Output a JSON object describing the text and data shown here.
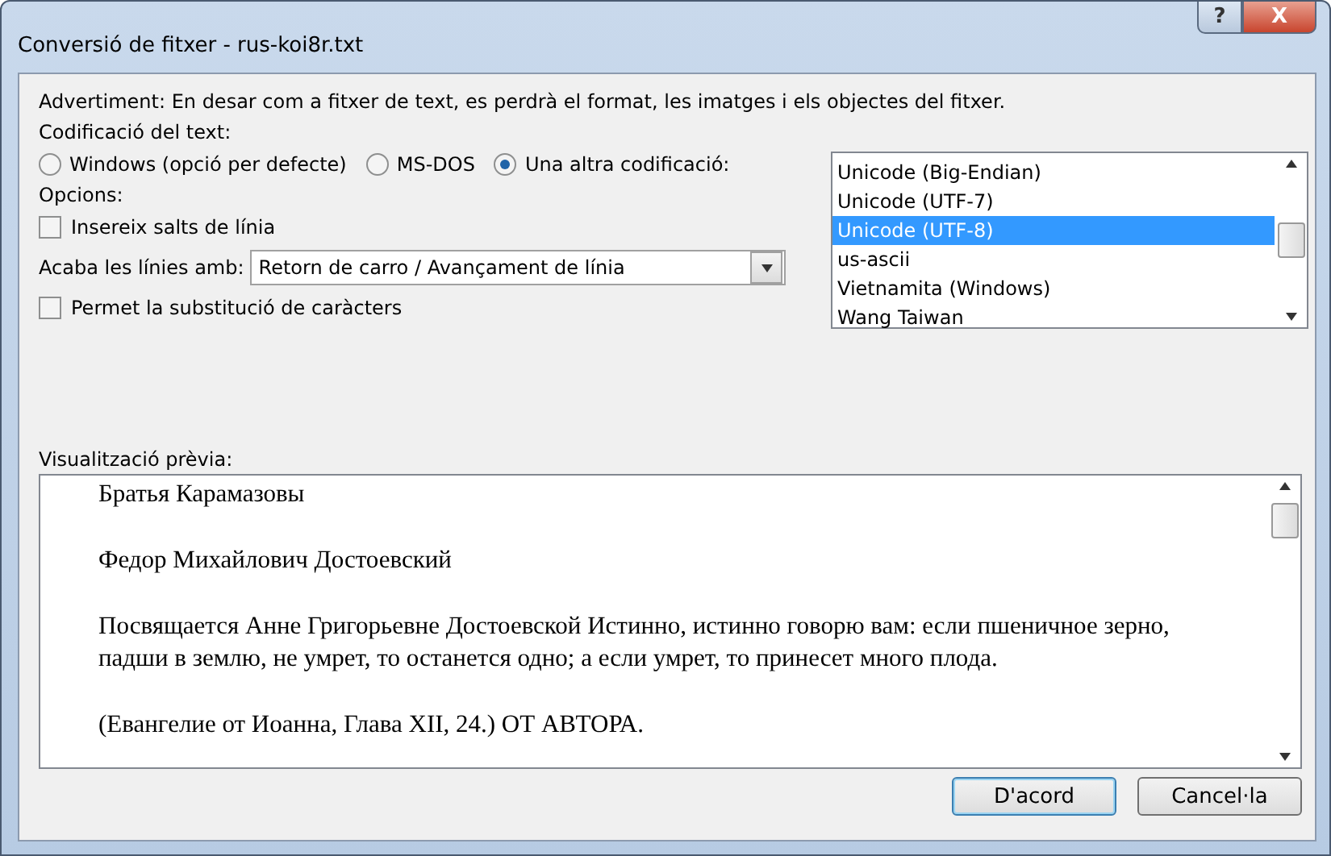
{
  "window": {
    "title": "Conversió de fitxer - rus-koi8r.txt",
    "buttons": [
      "?",
      "X"
    ]
  },
  "warning": "Advertiment: En desar com a fitxer de text, es perdrà el format, les imatges i els objectes del fitxer.",
  "encoding_label": "Codificació del text:",
  "encoding_options": [
    {
      "label": "Windows (opció per defecte)",
      "selected": false
    },
    {
      "label": "MS-DOS",
      "selected": false
    },
    {
      "label": "Una altra codificació:",
      "selected": true
    }
  ],
  "encodings": [
    {
      "label": "Unicode (Big-Endian)",
      "selected": false
    },
    {
      "label": "Unicode (UTF-7)",
      "selected": false
    },
    {
      "label": "Unicode (UTF-8)",
      "selected": true
    },
    {
      "label": "us-ascii",
      "selected": false
    },
    {
      "label": "Vietnamita (Windows)",
      "selected": false
    },
    {
      "label": "Wang Taiwan",
      "selected": false
    }
  ],
  "options_label": "Opcions:",
  "insert_breaks": {
    "label": "Insereix salts de línia",
    "checked": false
  },
  "line_end": {
    "label": "Acaba les línies amb:",
    "value": "Retorn de carro / Avançament de línia"
  },
  "allow_substitution": {
    "label": "Permet la substitució de caràcters",
    "checked": false
  },
  "preview": {
    "label": "Visualització prèvia:",
    "paragraphs": [
      "Братья Карамазовы",
      "Федор Михайлович Достоевский",
      "Посвящается Анне Григорьевне Достоевской Истинно, истинно говорю вам: если пшеничное зерно, падши в землю, не умрет, то останется одно; а если умрет, то принесет много плода.",
      "(Евангелие от Иоанна, Глава XII, 24.) ОТ АВТОРА."
    ]
  },
  "buttons": [
    "D'acord",
    "Cancel·la"
  ]
}
